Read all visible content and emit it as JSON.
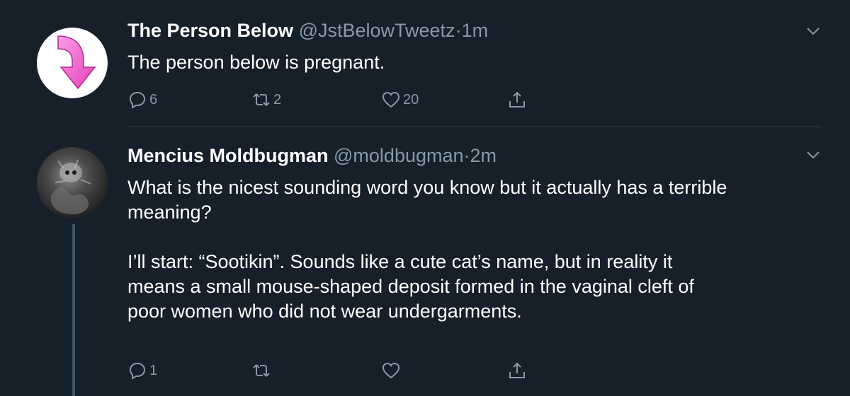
{
  "tweets": [
    {
      "name": "The Person Below",
      "handle": "@JstBelowTweetz",
      "separator": "·",
      "time": "1m",
      "text": "The person below is pregnant.",
      "replies": "6",
      "retweets": "2",
      "likes": "20",
      "avatar_icon": "pink-down-arrow-icon"
    },
    {
      "name": "Mencius Moldbugman",
      "handle": "@moldbugman",
      "separator": "·",
      "time": "2m",
      "text": "What is the nicest sounding word you know but it actually has a terrible\nmeaning?\n\nI’ll start: “Sootikin”. Sounds like a cute cat’s name, but in reality it\nmeans a small mouse-shaped deposit formed in the vaginal cleft of\npoor women who did not wear undergarments.",
      "replies": "1",
      "retweets": "",
      "likes": "",
      "avatar_icon": "grayscale-artwork-avatar"
    }
  ],
  "colors": {
    "background": "#15202b",
    "text": "#ffffff",
    "secondary_text": "#8899a6",
    "divider": "#38444d",
    "arrow_pink": "#ee66cc"
  }
}
